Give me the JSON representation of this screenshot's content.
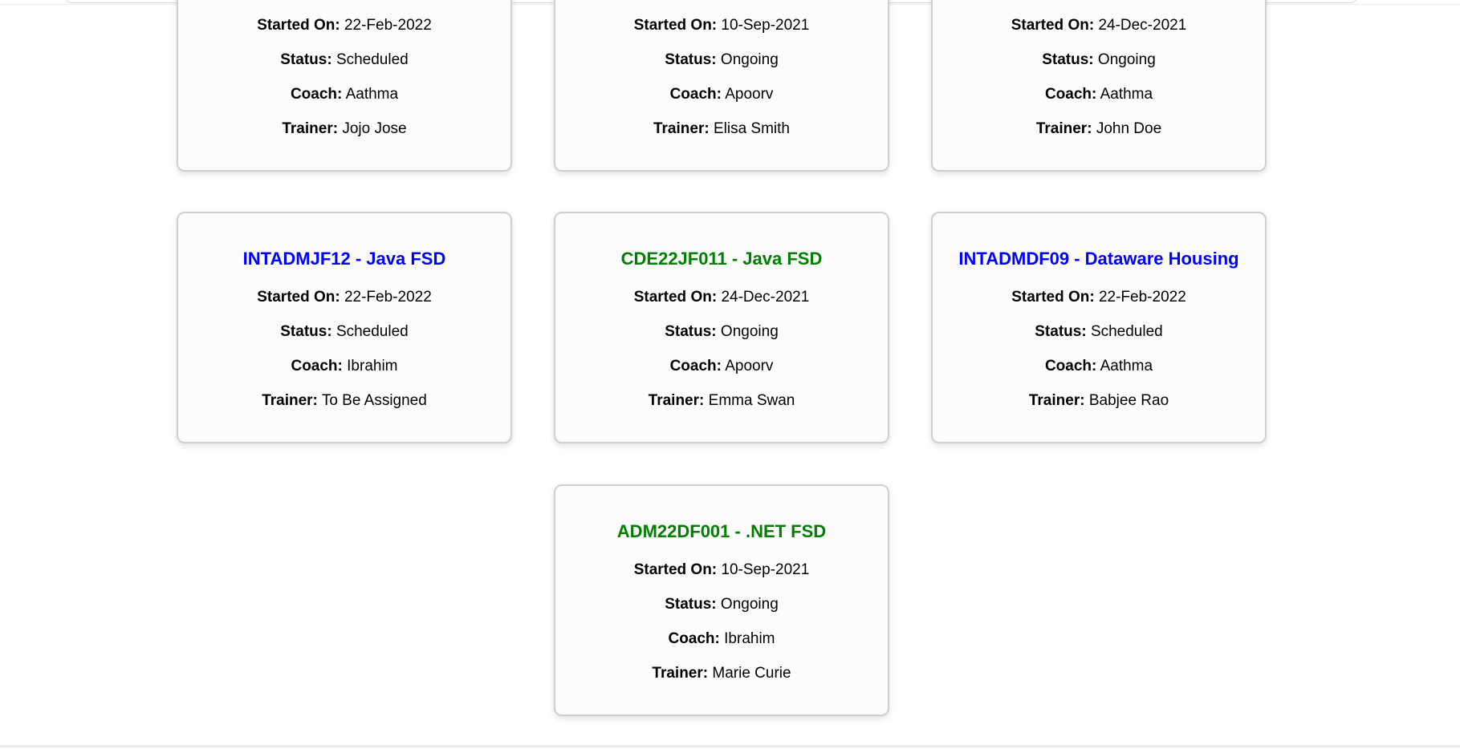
{
  "colors": {
    "scheduled": "#0000ff",
    "ongoing": "#008000"
  },
  "labels": {
    "started": "Started On:",
    "status": "Status:",
    "coach": "Coach:",
    "trainer": "Trainer:"
  },
  "cards": [
    {
      "title": "",
      "started": "22-Feb-2022",
      "status": "Scheduled",
      "coach": "Aathma",
      "trainer": "Jojo Jose"
    },
    {
      "title": "",
      "started": "10-Sep-2021",
      "status": "Ongoing",
      "coach": "Apoorv",
      "trainer": "Elisa Smith"
    },
    {
      "title": "",
      "started": "24-Dec-2021",
      "status": "Ongoing",
      "coach": "Aathma",
      "trainer": "John Doe"
    },
    {
      "title": "INTADMJF12 - Java FSD",
      "started": "22-Feb-2022",
      "status": "Scheduled",
      "coach": "Ibrahim",
      "trainer": "To Be Assigned"
    },
    {
      "title": "CDE22JF011 - Java FSD",
      "started": "24-Dec-2021",
      "status": "Ongoing",
      "coach": "Apoorv",
      "trainer": "Emma Swan"
    },
    {
      "title": "INTADMDF09 - Dataware Housing",
      "started": "22-Feb-2022",
      "status": "Scheduled",
      "coach": "Aathma",
      "trainer": "Babjee Rao"
    },
    {
      "title": "ADM22DF001 - .NET FSD",
      "started": "10-Sep-2021",
      "status": "Ongoing",
      "coach": "Ibrahim",
      "trainer": "Marie Curie"
    }
  ]
}
